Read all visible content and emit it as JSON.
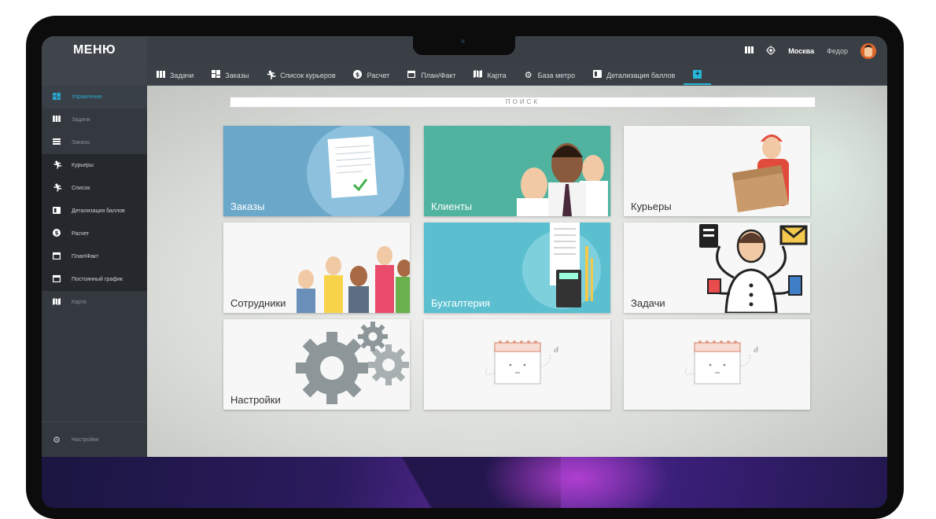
{
  "header": {
    "logo": "МЕНЮ",
    "city": "Москва",
    "user": "Федор",
    "icons": [
      "columns-icon",
      "location-target-icon",
      "avatar"
    ]
  },
  "tabs": [
    {
      "label": "Задачи",
      "icon": "columns-icon"
    },
    {
      "label": "Заказы",
      "icon": "dashboard-icon"
    },
    {
      "label": "Список курьеров",
      "icon": "runner-icon"
    },
    {
      "label": "Расчет",
      "icon": "dollar-coin-icon"
    },
    {
      "label": "План/Факт",
      "icon": "calendar-icon"
    },
    {
      "label": "Карта",
      "icon": "map-icon"
    },
    {
      "label": "База метро",
      "icon": "gear-icon"
    },
    {
      "label": "Детализация баллов",
      "icon": "detail-card-icon"
    }
  ],
  "sidebar": {
    "items": [
      {
        "label": "Управление",
        "icon": "dashboard-icon",
        "state": "active"
      },
      {
        "label": "Задачи",
        "icon": "columns-icon",
        "state": "muted"
      },
      {
        "label": "Заказы",
        "icon": "list-icon",
        "state": "muted"
      },
      {
        "label": "Курьеры",
        "icon": "runner-icon",
        "state": "dark"
      },
      {
        "label": "Список",
        "icon": "runner-icon",
        "state": "dark"
      },
      {
        "label": "Детализация баллов",
        "icon": "detail-card-icon",
        "state": "dark"
      },
      {
        "label": "Расчет",
        "icon": "dollar-coin-icon",
        "state": "dark"
      },
      {
        "label": "План\\Факт",
        "icon": "calendar-icon",
        "state": "dark"
      },
      {
        "label": "Постоянный график",
        "icon": "calendar-icon",
        "state": "dark"
      },
      {
        "label": "Карта",
        "icon": "map-icon",
        "state": "muted"
      }
    ],
    "settings": "Настройки"
  },
  "search": {
    "label": "ПОИСК"
  },
  "cards": [
    {
      "label": "Заказы",
      "color": "#6aa7c9"
    },
    {
      "label": "Клиенты",
      "color": "#4fb3a0"
    },
    {
      "label": "Курьеры",
      "color": "#f7f7f7"
    },
    {
      "label": "Сотрудники",
      "color": "#f7f7f7"
    },
    {
      "label": "Бухгалтерия",
      "color": "#5bbfd0"
    },
    {
      "label": "Задачи",
      "color": "#f7f7f7"
    },
    {
      "label": "Настройки",
      "color": "#f7f7f7"
    },
    {
      "label": "",
      "color": "#f7f7f7"
    },
    {
      "label": "",
      "color": "#f7f7f7"
    }
  ],
  "colors": {
    "accent": "#29b6d8",
    "sidebar": "#34393f",
    "header": "#3a3f45"
  }
}
